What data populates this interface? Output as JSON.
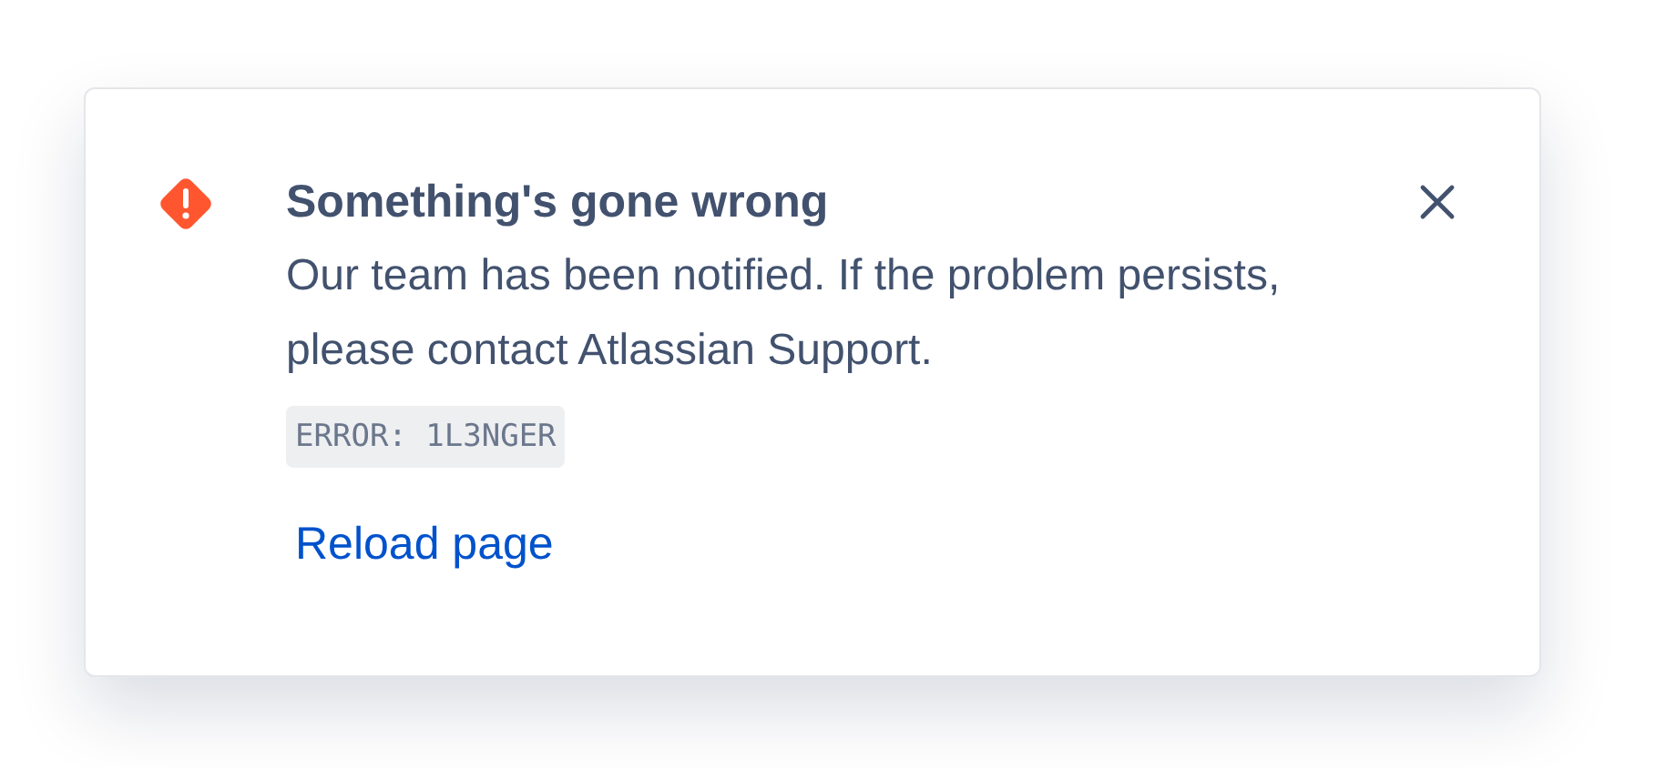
{
  "dialog": {
    "kind": "error",
    "title": "Something's gone wrong",
    "message": "Our team has been notified. If the problem persists, please contact Atlassian Support.",
    "error_code": "ERROR: 1L3NGER",
    "action": "Reload page"
  }
}
